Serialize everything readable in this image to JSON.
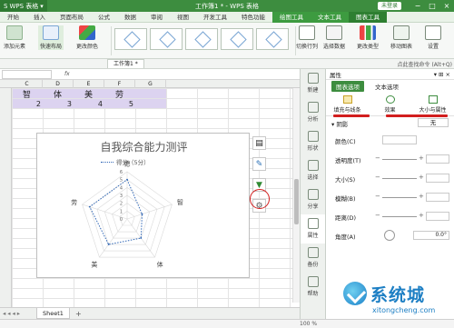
{
  "titlebar": {
    "app_name": "WPS 表格",
    "title": "工作簿1 * - WPS 表格",
    "login": "未登录",
    "controls": [
      "−",
      "□",
      "×"
    ]
  },
  "menu": {
    "tabs": [
      "开始",
      "插入",
      "页面布局",
      "公式",
      "数据",
      "审阅",
      "视图",
      "开发工具",
      "特色功能",
      "绘图工具",
      "文本工具",
      "图表工具"
    ]
  },
  "ribbon": {
    "add_element": "添加元素",
    "quick_layout": "快速布局",
    "change_color": "更改颜色",
    "switch_rowcol": "切换行列",
    "select_data": "选择数据",
    "change_type": "更改类型",
    "move_chart": "移动图表",
    "settings": "设置"
  },
  "qat": {
    "doc_tab": "工作簿1 *",
    "search": "点此查找命令 (Alt+Q)"
  },
  "sheet": {
    "columns": [
      "C",
      "D",
      "E",
      "F",
      "G"
    ],
    "header_row": [
      "智",
      "体",
      "美",
      "劳"
    ],
    "value_row": [
      "2",
      "3",
      "4",
      "5"
    ]
  },
  "chart": {
    "title": "自我综合能力测评",
    "legend": "得分（5分）"
  },
  "chart_data": {
    "type": "radar",
    "title": "自我综合能力测评",
    "categories": [
      "德",
      "智",
      "体",
      "美",
      "劳"
    ],
    "series": [
      {
        "name": "得分（5分）",
        "values": [
          5,
          2,
          3,
          4,
          5
        ]
      }
    ],
    "rlim": [
      0,
      6
    ],
    "tick_labels": [
      "0",
      "1",
      "2",
      "3",
      "4",
      "5",
      "6"
    ],
    "legend_position": "top"
  },
  "rnav": [
    "新建",
    "分析",
    "形状",
    "选择",
    "分享",
    "属性",
    "备份",
    "帮助"
  ],
  "pane": {
    "title": "属性",
    "tab_chart_options": "图表选项",
    "tab_text_options": "文本选项",
    "sub_fill": "填充与线条",
    "sub_effect": "效果",
    "sub_size": "大小与属性",
    "section_shadow": "阴影",
    "shadow_value": "无",
    "rows": [
      {
        "label": "颜色(C)",
        "value": ""
      },
      {
        "label": "透明度(T)",
        "value": ""
      },
      {
        "label": "大小(S)",
        "value": ""
      },
      {
        "label": "模糊(B)",
        "value": ""
      },
      {
        "label": "距离(D)",
        "value": ""
      },
      {
        "label": "角度(A)",
        "value": "0.0°"
      }
    ]
  },
  "sheettab": "Sheet1",
  "status": {
    "zoom": "100 %"
  },
  "watermark": {
    "name": "系统城",
    "url": "xitongcheng.com"
  }
}
